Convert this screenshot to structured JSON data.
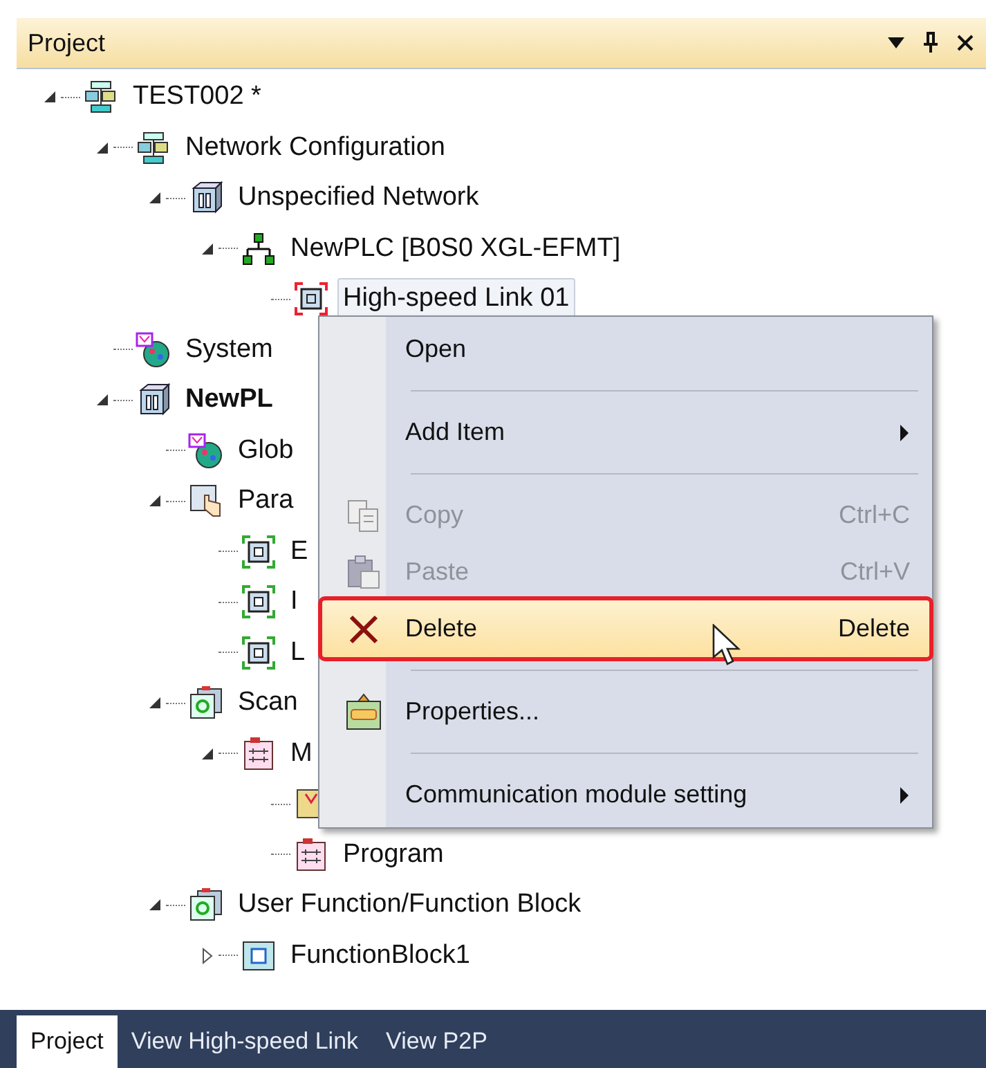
{
  "panel": {
    "title": "Project"
  },
  "tree": [
    {
      "label": "TEST002 *",
      "kind": "project",
      "expanded": true,
      "children": [
        {
          "label": "Network Configuration",
          "kind": "project",
          "expanded": true,
          "children": [
            {
              "label": "Unspecified Network",
              "kind": "network",
              "expanded": true,
              "children": [
                {
                  "label": "NewPLC [B0S0 XGL-EFMT]",
                  "kind": "topology",
                  "expanded": true,
                  "children": [
                    {
                      "label": "High-speed Link 01",
                      "kind": "link",
                      "selected": true
                    }
                  ]
                }
              ]
            }
          ]
        },
        {
          "label": "System",
          "kind": "variables",
          "selected": false
        },
        {
          "label": "NewPL",
          "kind": "network",
          "bold": true,
          "expanded": true,
          "children": [
            {
              "label": "Glob",
              "kind": "variables",
              "selected": false
            },
            {
              "label": "Para",
              "kind": "parameter",
              "expanded": true,
              "children": [
                {
                  "label": "E",
                  "kind": "param",
                  "selected": false
                },
                {
                  "label": "I",
                  "kind": "param",
                  "selected": false
                },
                {
                  "label": "L",
                  "kind": "param",
                  "selected": false
                }
              ]
            },
            {
              "label": "Scan",
              "kind": "scan",
              "expanded": true,
              "children": [
                {
                  "label": "M",
                  "kind": "program",
                  "expanded": true,
                  "children": [
                    {
                      "kind": "local",
                      "selected": false
                    },
                    {
                      "label": "Program",
                      "kind": "program",
                      "selected": false
                    }
                  ]
                }
              ]
            },
            {
              "label": "User Function/Function Block",
              "kind": "scan",
              "expanded": true,
              "children": [
                {
                  "label": "FunctionBlock1",
                  "kind": "block",
                  "expanded": false
                }
              ]
            }
          ]
        }
      ]
    }
  ],
  "context_menu": [
    {
      "kind": "item",
      "label": "Open",
      "disabled": false,
      "selected": false
    },
    {
      "kind": "separator"
    },
    {
      "kind": "item",
      "label": "Add Item",
      "disabled": false,
      "selected": false,
      "submenu": true
    },
    {
      "kind": "separator"
    },
    {
      "kind": "copy",
      "label": "Copy",
      "shortcut": "Ctrl+C",
      "disabled": true,
      "selected": false
    },
    {
      "kind": "paste",
      "label": "Paste",
      "shortcut": "Ctrl+V",
      "disabled": true,
      "selected": false
    },
    {
      "kind": "delete",
      "label": "Delete",
      "shortcut": "Delete",
      "disabled": false,
      "selected": true
    },
    {
      "kind": "separator"
    },
    {
      "kind": "properties",
      "label": "Properties...",
      "disabled": false,
      "selected": false
    },
    {
      "kind": "separator"
    },
    {
      "kind": "item",
      "label": "Communication module setting",
      "disabled": false,
      "selected": false,
      "submenu": true
    }
  ],
  "bottom_tabs": [
    {
      "label": "Project",
      "selected": true
    },
    {
      "label": "View High-speed Link",
      "selected": false
    },
    {
      "label": "View P2P",
      "selected": false
    }
  ]
}
